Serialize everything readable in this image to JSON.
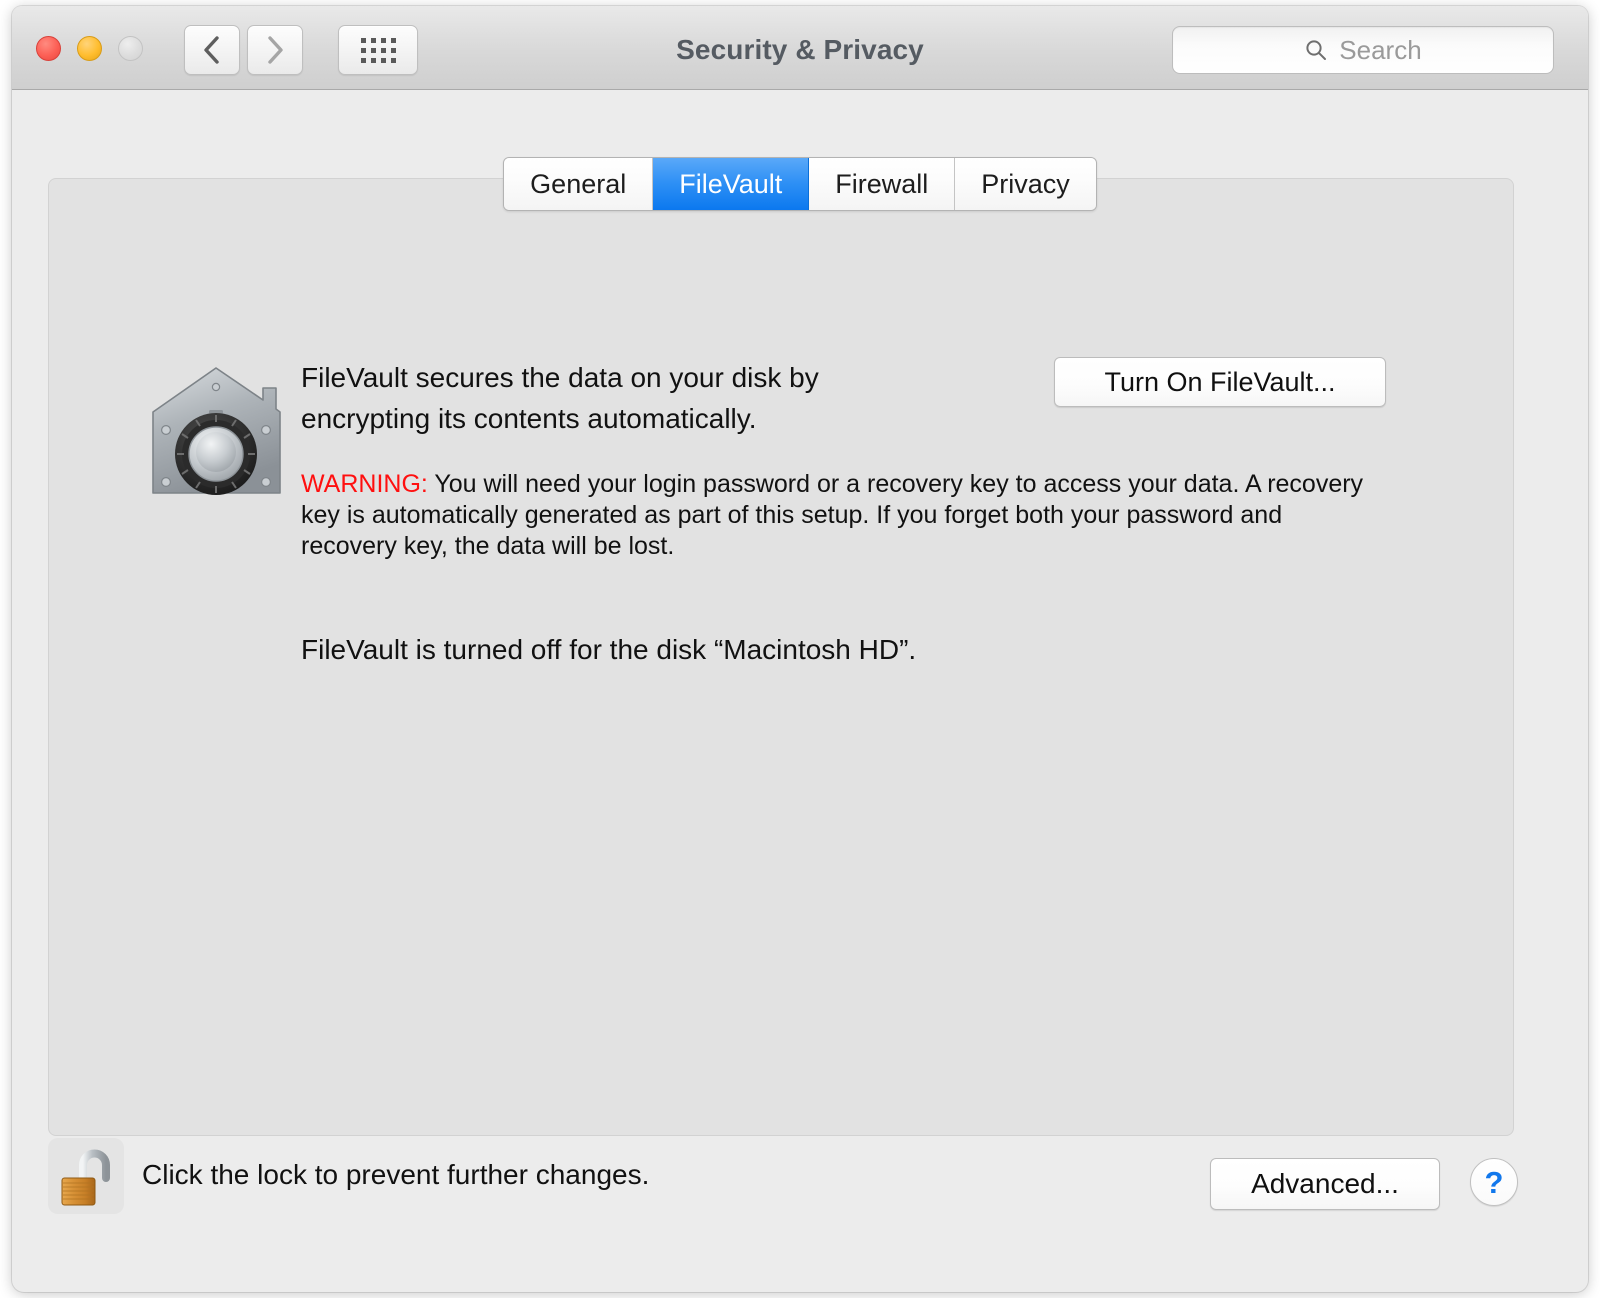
{
  "window": {
    "title": "Security & Privacy",
    "traffic_lights": [
      {
        "name": "close",
        "color": "#fc5f55"
      },
      {
        "name": "minimize",
        "color": "#ffbd2e"
      },
      {
        "name": "zoom",
        "color": "#dddddd"
      }
    ]
  },
  "toolbar": {
    "back_icon": "chevron-left-icon",
    "forward_icon": "chevron-right-icon",
    "show_all_icon": "grid-icon",
    "search": {
      "icon": "search-icon",
      "placeholder": "Search",
      "value": ""
    }
  },
  "tabs": [
    {
      "label": "General",
      "selected": false
    },
    {
      "label": "FileVault",
      "selected": true
    },
    {
      "label": "Firewall",
      "selected": false
    },
    {
      "label": "Privacy",
      "selected": false
    }
  ],
  "main": {
    "icon": "filevault-safe-icon",
    "intro": "FileVault secures the data on your disk by encrypting its contents automatically.",
    "warning_label": "WARNING:",
    "warning_text": " You will need your login password or a recovery key to access your data. A recovery key is automatically generated as part of this setup. If you forget both your password and recovery key, the data will be lost.",
    "status": "FileVault is turned off for the disk “Macintosh HD”.",
    "turn_on_button": "Turn On FileVault..."
  },
  "footer": {
    "lock_icon": "unlocked-padlock-icon",
    "lock_message": "Click the lock to prevent further changes.",
    "advanced_button": "Advanced...",
    "help_button": "?"
  },
  "colors": {
    "accent_blue": "#0b78ef",
    "warning_red": "#ff0f0f",
    "help_blue": "#1278ec",
    "window_bg": "#ececec",
    "panel_bg": "#e2e2e2"
  }
}
